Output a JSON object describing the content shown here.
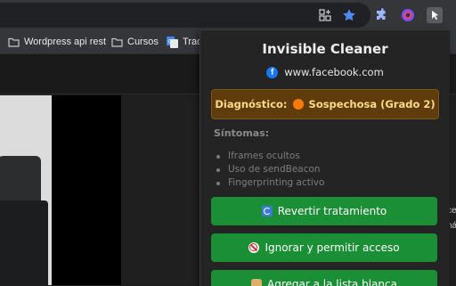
{
  "toolbar": {
    "icons": [
      "tab-search-icon",
      "bookmark-star-icon",
      "extension-puzzle-icon",
      "firefox-relay-icon",
      "invisible-cleaner-extension-icon"
    ],
    "star_color": "#4c8bf5"
  },
  "bookmarks": [
    {
      "label": "Wordpress api rest",
      "icon": "folder-icon"
    },
    {
      "label": "Cursos",
      "icon": "folder-icon"
    },
    {
      "label": "Trad",
      "icon": "google-translate-icon"
    }
  ],
  "page": {
    "fragments": [
      "ce",
      "ná"
    ]
  },
  "popup": {
    "title": "Invisible Cleaner",
    "site": "www.facebook.com",
    "site_icon": "facebook-icon",
    "diagnosis_label": "Diagnóstico:",
    "diagnosis_value": "Sospechosa (Grado 2)",
    "diagnosis_color": "#ff7a00",
    "symptoms_title": "Síntomas:",
    "symptoms": [
      "Iframes ocultos",
      "Uso de sendBeacon",
      "Fingerprinting activo"
    ],
    "buttons": {
      "revert": "Revertir tratamiento",
      "ignore": "Ignorar y permitir acceso",
      "whitelist": "Agregar a la lista blanca"
    },
    "button_color": "#1a8f35"
  }
}
